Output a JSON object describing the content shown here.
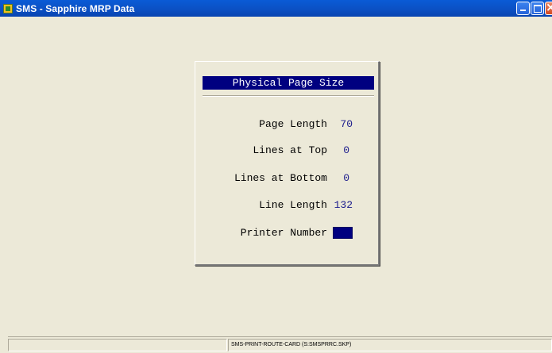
{
  "window": {
    "title": "SMS - Sapphire MRP Data"
  },
  "dialog": {
    "title": "Physical Page Size",
    "fields": [
      {
        "label": "Page Length",
        "value": "70"
      },
      {
        "label": "Lines at Top",
        "value": "0"
      },
      {
        "label": "Lines at Bottom",
        "value": "0"
      },
      {
        "label": "Line Length",
        "value": "132"
      },
      {
        "label": "Printer Number",
        "value": ""
      }
    ]
  },
  "statusbar": {
    "pane1": "",
    "pane2": "SMS-PRINT-ROUTE-CARD (S:SMSPRRC.SKP)"
  },
  "colors": {
    "title_bar": "#0b4fc2",
    "dialog_title_bg": "#000080",
    "value_text": "#1a1a8c",
    "background": "#ece9d8"
  }
}
